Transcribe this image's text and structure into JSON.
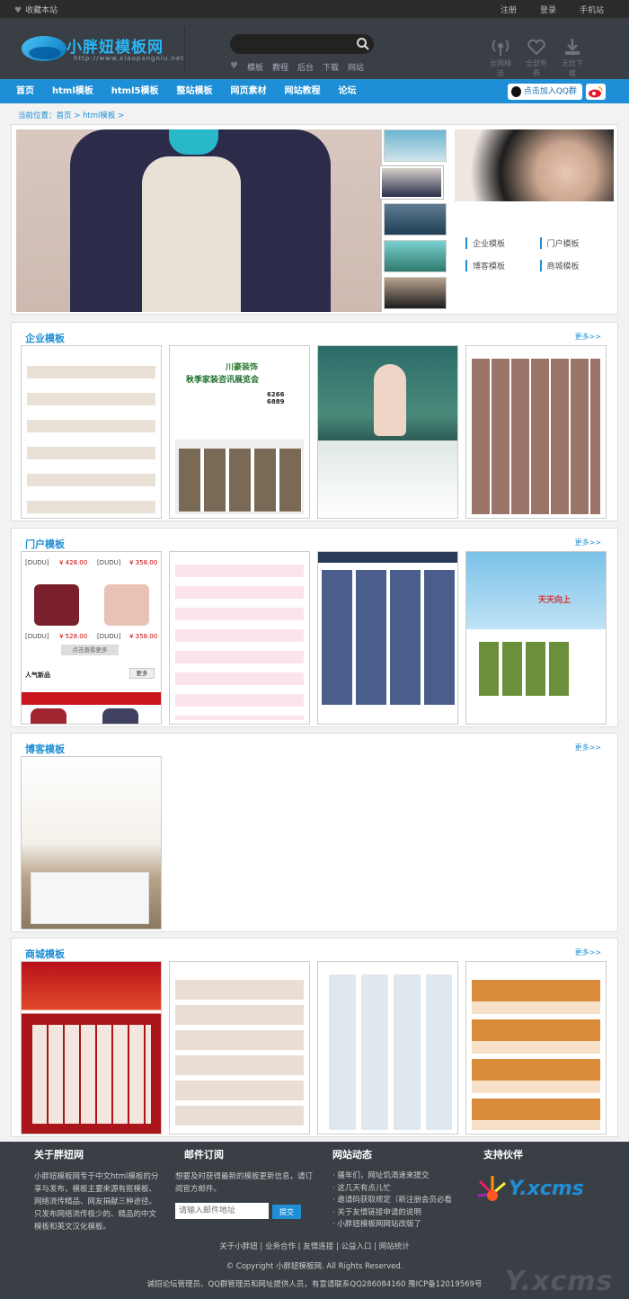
{
  "topbar": {
    "favorite": "收藏本站",
    "links": [
      "注册",
      "登录",
      "手机站"
    ]
  },
  "header": {
    "logo_name": "小胖妞模板网",
    "logo_url": "http://www.xiaopangniu.net",
    "hotwords": [
      "模板",
      "教程",
      "后台",
      "下载",
      "网站"
    ],
    "tools": [
      "全网精选",
      "全部免费",
      "无忧下载"
    ]
  },
  "nav": {
    "items": [
      "首页",
      "html模板",
      "html5模板",
      "整站模板",
      "网页素材",
      "网站教程",
      "论坛"
    ],
    "qq_join": "点击加入QQ群"
  },
  "breadcrumb": "当前位置：首页 > html模板 >",
  "banner": {
    "categories": [
      "企业模板",
      "门户模板",
      "博客模板",
      "商城模板"
    ]
  },
  "sections": [
    {
      "title": "企业模板",
      "more": "更多>>"
    },
    {
      "title": "门户模板",
      "more": "更多>>"
    },
    {
      "title": "博客模板",
      "more": "更多>>"
    },
    {
      "title": "商城模板",
      "more": "更多>>"
    }
  ],
  "card_texts": {
    "decor": "川豪装饰",
    "decor_sub": "秋季家装咨讯展览会",
    "decor_phone": "6266 6889",
    "bag_brand": "[DUDU]",
    "bag_price1": "¥ 428.00",
    "bag_price2": "¥ 358.00",
    "bag_price3": "¥ 528.00",
    "bag_more": "点击查看更多",
    "bag_hot": "人气新品",
    "bag_more2": "更多",
    "portal_slogan": "天天向上"
  },
  "footer": {
    "about_title": "关于胖妞网",
    "about_text": "小胖妞模板网专于中文html模板的分享与发布，模板主要来源有抠模板、网络流传精品、网友捐献三种途径。只发布网络流传极少的、精品的中文模板和英文汉化模板。",
    "mail_title": "邮件订阅",
    "mail_text": "想要及时获得最新的模板更新信息，请订阅官方邮件。",
    "mail_placeholder": "请输入邮件地址",
    "mail_button": "提交",
    "news_title": "网站动态",
    "news": [
      "· 骚年们，网址饥渴速来提交",
      "· 这几天有点儿忙",
      "· 邀请码获取规定（新注册会员必看",
      "· 关于友情链接申请的说明",
      "· 小胖妞模板网网站改版了"
    ],
    "partner_title": "支持伙伴",
    "partner_logo": "Y.xcms",
    "links": "关于小胖妞 | 业务合作 | 友情连接 | 公益入口 | 网站统计",
    "copyright": "© Copyright 小胖妞模板网. All Rights Reserved.",
    "icp": "诚招论坛管理员、QQ群管理员和网址提供人员，有意请联系QQ286084160 豫ICP备12019569号",
    "watermark": "Y.xcms"
  }
}
